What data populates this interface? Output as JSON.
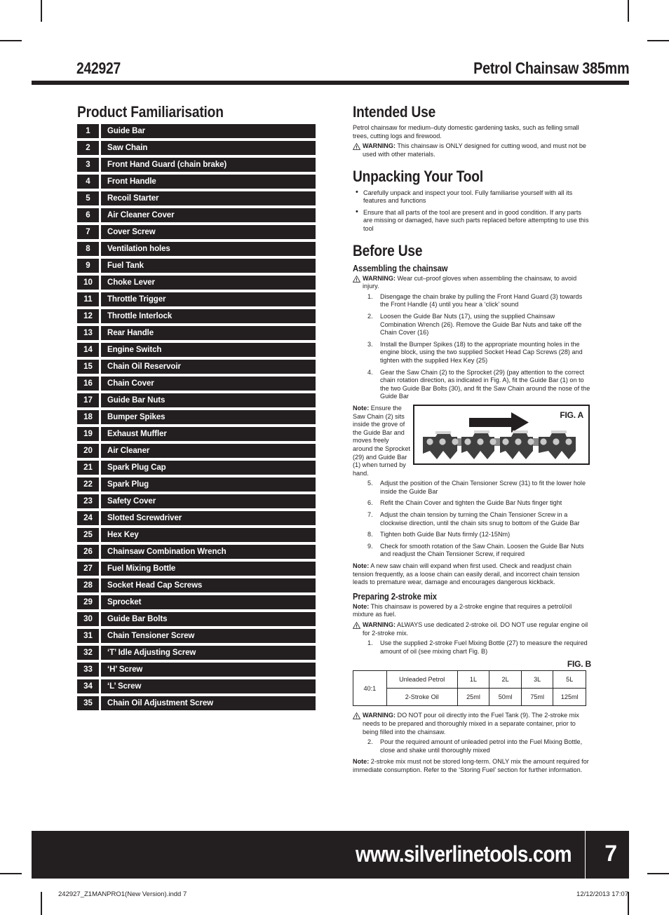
{
  "header": {
    "model_number": "242927",
    "product_title": "Petrol Chainsaw 385mm"
  },
  "left_column": {
    "title": "Product Familiarisation",
    "parts": [
      {
        "num": "1",
        "label": "Guide Bar"
      },
      {
        "num": "2",
        "label": "Saw Chain"
      },
      {
        "num": "3",
        "label": "Front Hand Guard (chain brake)"
      },
      {
        "num": "4",
        "label": "Front Handle"
      },
      {
        "num": "5",
        "label": "Recoil Starter"
      },
      {
        "num": "6",
        "label": "Air Cleaner Cover"
      },
      {
        "num": "7",
        "label": "Cover Screw"
      },
      {
        "num": "8",
        "label": "Ventilation holes"
      },
      {
        "num": "9",
        "label": "Fuel Tank"
      },
      {
        "num": "10",
        "label": "Choke Lever"
      },
      {
        "num": "11",
        "label": "Throttle Trigger"
      },
      {
        "num": "12",
        "label": "Throttle Interlock"
      },
      {
        "num": "13",
        "label": "Rear Handle"
      },
      {
        "num": "14",
        "label": "Engine Switch"
      },
      {
        "num": "15",
        "label": "Chain Oil Reservoir"
      },
      {
        "num": "16",
        "label": "Chain Cover"
      },
      {
        "num": "17",
        "label": "Guide Bar Nuts"
      },
      {
        "num": "18",
        "label": "Bumper Spikes"
      },
      {
        "num": "19",
        "label": "Exhaust Muffler"
      },
      {
        "num": "20",
        "label": "Air Cleaner"
      },
      {
        "num": "21",
        "label": "Spark Plug Cap"
      },
      {
        "num": "22",
        "label": "Spark Plug"
      },
      {
        "num": "23",
        "label": "Safety Cover"
      },
      {
        "num": "24",
        "label": "Slotted Screwdriver"
      },
      {
        "num": "25",
        "label": "Hex Key"
      },
      {
        "num": "26",
        "label": "Chainsaw Combination Wrench"
      },
      {
        "num": "27",
        "label": "Fuel Mixing Bottle"
      },
      {
        "num": "28",
        "label": "Socket Head Cap Screws"
      },
      {
        "num": "29",
        "label": "Sprocket"
      },
      {
        "num": "30",
        "label": "Guide Bar Bolts"
      },
      {
        "num": "31",
        "label": "Chain Tensioner Screw"
      },
      {
        "num": "32",
        "label": "‘T’ Idle Adjusting Screw"
      },
      {
        "num": "33",
        "label": "‘H’ Screw"
      },
      {
        "num": "34",
        "label": "‘L’ Screw"
      },
      {
        "num": "35",
        "label": "Chain Oil Adjustment Screw"
      }
    ]
  },
  "right_column": {
    "intended_use": {
      "title": "Intended Use",
      "paragraph": "Petrol chainsaw for medium–duty domestic gardening tasks, such as felling small trees, cutting logs and firewood.",
      "warning_label": "WARNING:",
      "warning_text": " This chainsaw is ONLY designed for cutting wood, and must not be used with other materials."
    },
    "unpacking": {
      "title": "Unpacking Your Tool",
      "bullets": [
        "Carefully unpack and inspect your tool. Fully familiarise yourself with all its features and functions",
        "Ensure that all parts of the tool are present and in good condition. If any parts are missing or damaged, have such parts replaced before attempting to use this tool"
      ]
    },
    "before_use": {
      "title": "Before Use",
      "assembling": {
        "subtitle": "Assembling the chainsaw",
        "warning_label": "WARNING:",
        "warning_text": " Wear cut–proof gloves when assembling the chainsaw, to avoid injury.",
        "steps_1_4": [
          "Disengage the chain brake by pulling the Front Hand Guard (3) towards the Front Handle (4) until you hear a ‘click’ sound",
          "Loosen the Guide Bar Nuts (17), using the supplied Chainsaw Combination Wrench (26). Remove the Guide Bar Nuts and take off the Chain Cover (16)",
          "Install the Bumper Spikes (18) to the appropriate mounting holes in the engine block, using the two supplied Socket Head Cap Screws (28) and tighten with the supplied Hex Key (25)",
          "Gear the Saw Chain (2) to the Sprocket (29) (pay attention to the correct chain rotation direction, as indicated in Fig. A), fit the Guide Bar (1) on to the two Guide Bar Bolts (30), and fit the Saw Chain around the nose of the Guide Bar"
        ],
        "fig_a_note_label": "Note:",
        "fig_a_note_text": " Ensure the Saw Chain (2) sits inside the grove of the Guide Bar and moves freely around the Sprocket (29) and Guide Bar (1) when turned by hand.",
        "fig_a_label": "FIG. A",
        "steps_5_9": [
          "Adjust the position of the Chain Tensioner Screw (31) to fit the lower hole inside the Guide Bar",
          "Refit the Chain Cover and tighten the Guide Bar Nuts finger tight",
          "Adjust the chain tension by turning the Chain Tensioner Screw in a clockwise direction, until the chain sits snug to bottom of the Guide Bar",
          "Tighten both Guide Bar Nuts firmly (12-15Nm)",
          "Check for smooth rotation of the Saw Chain. Loosen the Guide Bar Nuts and readjust the Chain Tensioner Screw, if required"
        ],
        "note_label": "Note:",
        "note_text": " A new saw chain will expand when first used. Check and readjust chain tension frequently, as a loose chain can easily derail, and incorrect chain tension leads to premature wear, damage and encourages dangerous kickback."
      },
      "two_stroke": {
        "subtitle": "Preparing 2-stroke mix",
        "note1_label": "Note:",
        "note1_text": " This chainsaw is powered by a 2-stroke engine that requires a petrol/oil mixture as fuel.",
        "warning1_label": "WARNING:",
        "warning1_text": " ALWAYS use dedicated 2-stroke oil. DO NOT use regular engine oil for 2-stroke mix.",
        "step1": "Use the supplied 2-stroke Fuel Mixing Bottle (27) to measure the required amount of oil (see mixing chart Fig. B)",
        "fig_b_label": "FIG. B",
        "warning2_label": "WARNING:",
        "warning2_text": " DO NOT pour oil directly into the Fuel Tank (9). The 2-stroke mix needs to be prepared and thoroughly mixed in a separate container, prior to being filled into the chainsaw.",
        "step2": "Pour the required amount of unleaded petrol into the Fuel Mixing Bottle, close and shake until thoroughly mixed",
        "note2_label": "Note:",
        "note2_text": " 2-stroke mix must not be stored long-term. ONLY mix the amount required for immediate consumption. Refer to the ‘Storing Fuel’ section for further information."
      }
    }
  },
  "fig_b_table": {
    "ratio": "40:1",
    "rows": [
      {
        "name": "Unleaded Petrol",
        "values": [
          "1L",
          "2L",
          "3L",
          "5L"
        ]
      },
      {
        "name": "2-Stroke Oil",
        "values": [
          "25ml",
          "50ml",
          "75ml",
          "125ml"
        ]
      }
    ]
  },
  "footer": {
    "url": "www.silverlinetools.com",
    "page_number": "7",
    "imprint_file": "242927_Z1MANPRO1(New Version).indd   7",
    "imprint_date": "12/12/2013   17:07"
  },
  "colors": {
    "ink": "#231f20",
    "paper": "#ffffff"
  }
}
